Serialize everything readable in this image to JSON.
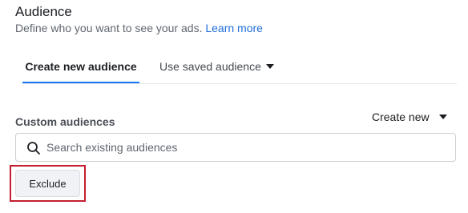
{
  "header": {
    "title": "Audience",
    "description": "Define who you want to see your ads.",
    "learn_more": "Learn more"
  },
  "tabs": [
    {
      "label": "Create new audience",
      "active": true
    },
    {
      "label": "Use saved audience",
      "active": false
    }
  ],
  "custom_audiences": {
    "label": "Custom audiences",
    "create_new": "Create new",
    "search": {
      "value": "",
      "placeholder": "Search existing audiences"
    },
    "exclude_label": "Exclude"
  },
  "icons": {
    "search": "search-icon",
    "dropdown": "caret-down-icon"
  },
  "colors": {
    "accent": "#1877f2",
    "link": "#216fdb",
    "highlight": "#c41e30"
  }
}
